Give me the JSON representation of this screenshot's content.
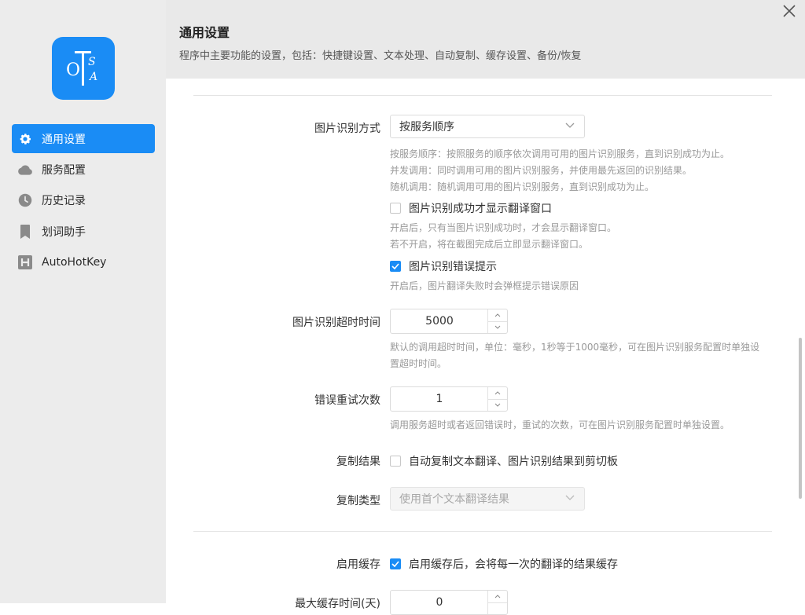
{
  "logo": {
    "letters": [
      "O",
      "T",
      "S",
      "A"
    ]
  },
  "sidebar": {
    "items": [
      {
        "label": "通用设置",
        "icon": "gear-icon",
        "active": true
      },
      {
        "label": "服务配置",
        "icon": "cloud-icon"
      },
      {
        "label": "历史记录",
        "icon": "clock-icon"
      },
      {
        "label": "划词助手",
        "icon": "bookmark-icon"
      },
      {
        "label": "AutoHotKey",
        "icon": "autohotkey-icon"
      }
    ]
  },
  "header": {
    "title": "通用设置",
    "subtitle": "程序中主要功能的设置，包括：快捷键设置、文本处理、自动复制、缓存设置、备份/恢复"
  },
  "settings": {
    "ocr_mode": {
      "label": "图片识别方式",
      "value": "按服务顺序",
      "help": [
        "按服务顺序：按照服务的顺序依次调用可用的图片识别服务，直到识别成功为止。",
        "并发调用：同时调用可用的图片识别服务，并使用最先返回的识别结果。",
        "随机调用：随机调用可用的图片识别服务，直到识别成功为止。"
      ]
    },
    "show_on_success": {
      "label": "图片识别成功才显示翻译窗口",
      "checked": false,
      "help": [
        "开启后，只有当图片识别成功时，才会显示翻译窗口。",
        "若不开启，将在截图完成后立即显示翻译窗口。"
      ]
    },
    "error_tip": {
      "label": "图片识别错误提示",
      "checked": true,
      "help": "开启后，图片翻译失败时会弹框提示错误原因"
    },
    "timeout": {
      "label": "图片识别超时时间",
      "value": "5000",
      "help": [
        "默认的调用超时时间，单位：毫秒，1秒等于1000毫秒，可在图片识别服务配置时单独设",
        "置超时时间。"
      ]
    },
    "retry": {
      "label": "错误重试次数",
      "value": "1",
      "help": "调用服务超时或者返回错误时，重试的次数，可在图片识别服务配置时单独设置。"
    },
    "copy_result": {
      "label": "复制结果",
      "checkbox_label": "自动复制文本翻译、图片识别结果到剪切板",
      "checked": false
    },
    "copy_type": {
      "label": "复制类型",
      "value": "使用首个文本翻译结果"
    },
    "enable_cache": {
      "label": "启用缓存",
      "checkbox_label": "启用缓存后，会将每一次的翻译的结果缓存",
      "checked": true
    },
    "cache_time": {
      "label": "最大缓存时间(天)",
      "value": "0"
    }
  },
  "colors": {
    "accent": "#1a8cf5",
    "sidebar_bg": "#ececec",
    "header_bg": "#e9e9e9"
  }
}
